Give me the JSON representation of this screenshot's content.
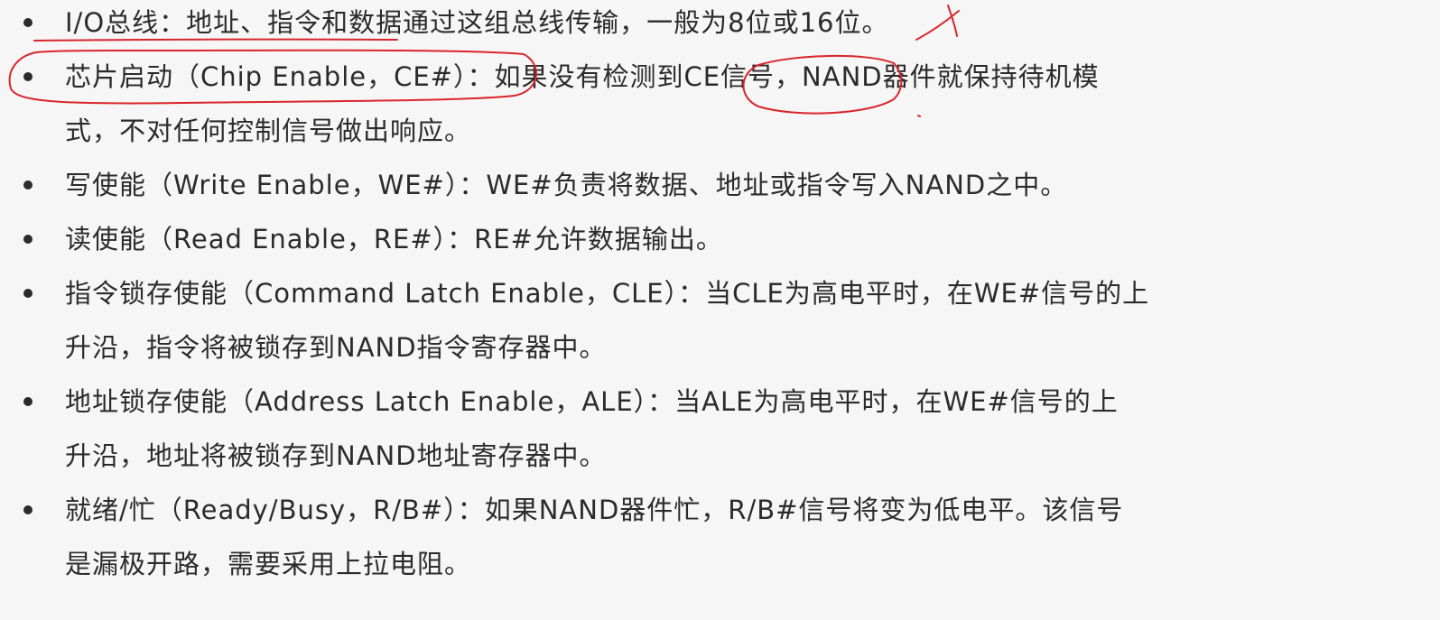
{
  "items": [
    {
      "lines": [
        "I/O总线：地址、指令和数据通过这组总线传输，一般为8位或16位。"
      ]
    },
    {
      "lines": [
        "芯片启动（Chip Enable，CE#）：如果没有检测到CE信号，NAND器件就保持待机模",
        "式，不对任何控制信号做出响应。"
      ]
    },
    {
      "lines": [
        "写使能（Write Enable，WE#）：WE#负责将数据、地址或指令写入NAND之中。"
      ]
    },
    {
      "lines": [
        "读使能（Read Enable，RE#）：RE#允许数据输出。"
      ]
    },
    {
      "lines": [
        "指令锁存使能（Command Latch Enable，CLE）：当CLE为高电平时，在WE#信号的上",
        "升沿，指令将被锁存到NAND指令寄存器中。"
      ]
    },
    {
      "lines": [
        "地址锁存使能（Address Latch Enable，ALE）：当ALE为高电平时，在WE#信号的上",
        "升沿，地址将被锁存到NAND地址寄存器中。"
      ]
    },
    {
      "lines": [
        "就绪/忙（Ready/Busy，R/B#）：如果NAND器件忙，R/B#信号将变为低电平。该信号",
        "是漏极开路，需要采用上拉电阻。"
      ]
    }
  ],
  "annotation_color": "#d9252a"
}
